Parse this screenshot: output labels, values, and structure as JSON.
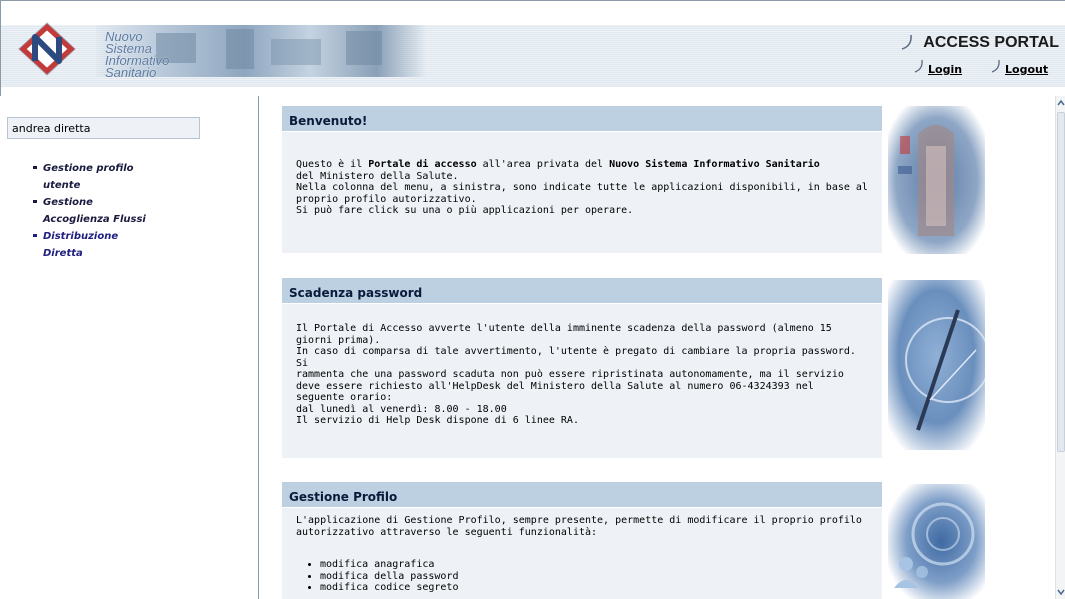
{
  "header": {
    "logo_lines": [
      "Nuovo",
      "Sistema",
      "Informativo",
      "Sanitario"
    ],
    "portal_title": "ACCESS PORTAL",
    "login_label": "Login",
    "logout_label": "Logout"
  },
  "sidebar": {
    "user_name": "andrea diretta",
    "menu": [
      {
        "line1": "Gestione profilo",
        "line2": "utente"
      },
      {
        "line1": "Gestione",
        "line2": "Accoglienza Flussi"
      },
      {
        "line1": "Distribuzione",
        "line2": "Diretta"
      }
    ]
  },
  "panels": {
    "welcome": {
      "title": "Benvenuto!",
      "l1_pre": "Questo è il ",
      "l1_b1": "Portale di accesso",
      "l1_mid": " all'area privata del ",
      "l1_b2": "Nuovo Sistema Informativo Sanitario",
      "l2": "del Ministero della Salute.",
      "l3": "Nella colonna del menu, a sinistra, sono indicate tutte le applicazioni disponibili, in base al",
      "l4": "proprio profilo autorizzativo.",
      "l5": "Si può fare click su una o più applicazioni per operare."
    },
    "password": {
      "title": "Scadenza password",
      "lines": [
        "Il Portale di Accesso avverte l'utente della imminente scadenza della password (almeno 15",
        "giorni prima).",
        "In caso di comparsa di tale avvertimento, l'utente è pregato di cambiare la propria password. Si",
        "rammenta che una password scaduta non può essere ripristinata autonomamente, ma il servizio",
        "deve essere richiesto all'HelpDesk del Ministero della Salute al numero 06-4324393 nel",
        "seguente orario:",
        "dal lunedì al venerdì: 8.00 - 18.00",
        "Il servizio di Help Desk dispone di 6 linee RA."
      ]
    },
    "profile": {
      "title": "Gestione Profilo",
      "l1": "L'applicazione di Gestione Profilo, sempre presente, permette di modificare il proprio profilo",
      "l2": "autorizzativo attraverso le seguenti funzionalità:",
      "items": [
        "modifica anagrafica",
        "modifica della password",
        "modifica codice segreto"
      ]
    }
  },
  "colors": {
    "panel_header": "#bdd0e2",
    "panel_body": "#eef2f6",
    "menu_text": "#1a1a40"
  }
}
